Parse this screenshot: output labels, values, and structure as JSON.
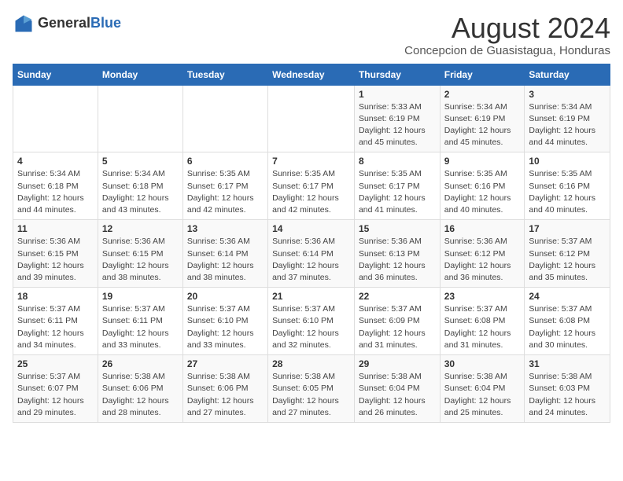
{
  "logo": {
    "text_general": "General",
    "text_blue": "Blue"
  },
  "title": {
    "month_year": "August 2024",
    "location": "Concepcion de Guasistagua, Honduras"
  },
  "days_of_week": [
    "Sunday",
    "Monday",
    "Tuesday",
    "Wednesday",
    "Thursday",
    "Friday",
    "Saturday"
  ],
  "weeks": [
    [
      {
        "day": "",
        "info": ""
      },
      {
        "day": "",
        "info": ""
      },
      {
        "day": "",
        "info": ""
      },
      {
        "day": "",
        "info": ""
      },
      {
        "day": "1",
        "info": "Sunrise: 5:33 AM\nSunset: 6:19 PM\nDaylight: 12 hours\nand 45 minutes."
      },
      {
        "day": "2",
        "info": "Sunrise: 5:34 AM\nSunset: 6:19 PM\nDaylight: 12 hours\nand 45 minutes."
      },
      {
        "day": "3",
        "info": "Sunrise: 5:34 AM\nSunset: 6:19 PM\nDaylight: 12 hours\nand 44 minutes."
      }
    ],
    [
      {
        "day": "4",
        "info": "Sunrise: 5:34 AM\nSunset: 6:18 PM\nDaylight: 12 hours\nand 44 minutes."
      },
      {
        "day": "5",
        "info": "Sunrise: 5:34 AM\nSunset: 6:18 PM\nDaylight: 12 hours\nand 43 minutes."
      },
      {
        "day": "6",
        "info": "Sunrise: 5:35 AM\nSunset: 6:17 PM\nDaylight: 12 hours\nand 42 minutes."
      },
      {
        "day": "7",
        "info": "Sunrise: 5:35 AM\nSunset: 6:17 PM\nDaylight: 12 hours\nand 42 minutes."
      },
      {
        "day": "8",
        "info": "Sunrise: 5:35 AM\nSunset: 6:17 PM\nDaylight: 12 hours\nand 41 minutes."
      },
      {
        "day": "9",
        "info": "Sunrise: 5:35 AM\nSunset: 6:16 PM\nDaylight: 12 hours\nand 40 minutes."
      },
      {
        "day": "10",
        "info": "Sunrise: 5:35 AM\nSunset: 6:16 PM\nDaylight: 12 hours\nand 40 minutes."
      }
    ],
    [
      {
        "day": "11",
        "info": "Sunrise: 5:36 AM\nSunset: 6:15 PM\nDaylight: 12 hours\nand 39 minutes."
      },
      {
        "day": "12",
        "info": "Sunrise: 5:36 AM\nSunset: 6:15 PM\nDaylight: 12 hours\nand 38 minutes."
      },
      {
        "day": "13",
        "info": "Sunrise: 5:36 AM\nSunset: 6:14 PM\nDaylight: 12 hours\nand 38 minutes."
      },
      {
        "day": "14",
        "info": "Sunrise: 5:36 AM\nSunset: 6:14 PM\nDaylight: 12 hours\nand 37 minutes."
      },
      {
        "day": "15",
        "info": "Sunrise: 5:36 AM\nSunset: 6:13 PM\nDaylight: 12 hours\nand 36 minutes."
      },
      {
        "day": "16",
        "info": "Sunrise: 5:36 AM\nSunset: 6:12 PM\nDaylight: 12 hours\nand 36 minutes."
      },
      {
        "day": "17",
        "info": "Sunrise: 5:37 AM\nSunset: 6:12 PM\nDaylight: 12 hours\nand 35 minutes."
      }
    ],
    [
      {
        "day": "18",
        "info": "Sunrise: 5:37 AM\nSunset: 6:11 PM\nDaylight: 12 hours\nand 34 minutes."
      },
      {
        "day": "19",
        "info": "Sunrise: 5:37 AM\nSunset: 6:11 PM\nDaylight: 12 hours\nand 33 minutes."
      },
      {
        "day": "20",
        "info": "Sunrise: 5:37 AM\nSunset: 6:10 PM\nDaylight: 12 hours\nand 33 minutes."
      },
      {
        "day": "21",
        "info": "Sunrise: 5:37 AM\nSunset: 6:10 PM\nDaylight: 12 hours\nand 32 minutes."
      },
      {
        "day": "22",
        "info": "Sunrise: 5:37 AM\nSunset: 6:09 PM\nDaylight: 12 hours\nand 31 minutes."
      },
      {
        "day": "23",
        "info": "Sunrise: 5:37 AM\nSunset: 6:08 PM\nDaylight: 12 hours\nand 31 minutes."
      },
      {
        "day": "24",
        "info": "Sunrise: 5:37 AM\nSunset: 6:08 PM\nDaylight: 12 hours\nand 30 minutes."
      }
    ],
    [
      {
        "day": "25",
        "info": "Sunrise: 5:37 AM\nSunset: 6:07 PM\nDaylight: 12 hours\nand 29 minutes."
      },
      {
        "day": "26",
        "info": "Sunrise: 5:38 AM\nSunset: 6:06 PM\nDaylight: 12 hours\nand 28 minutes."
      },
      {
        "day": "27",
        "info": "Sunrise: 5:38 AM\nSunset: 6:06 PM\nDaylight: 12 hours\nand 27 minutes."
      },
      {
        "day": "28",
        "info": "Sunrise: 5:38 AM\nSunset: 6:05 PM\nDaylight: 12 hours\nand 27 minutes."
      },
      {
        "day": "29",
        "info": "Sunrise: 5:38 AM\nSunset: 6:04 PM\nDaylight: 12 hours\nand 26 minutes."
      },
      {
        "day": "30",
        "info": "Sunrise: 5:38 AM\nSunset: 6:04 PM\nDaylight: 12 hours\nand 25 minutes."
      },
      {
        "day": "31",
        "info": "Sunrise: 5:38 AM\nSunset: 6:03 PM\nDaylight: 12 hours\nand 24 minutes."
      }
    ]
  ]
}
